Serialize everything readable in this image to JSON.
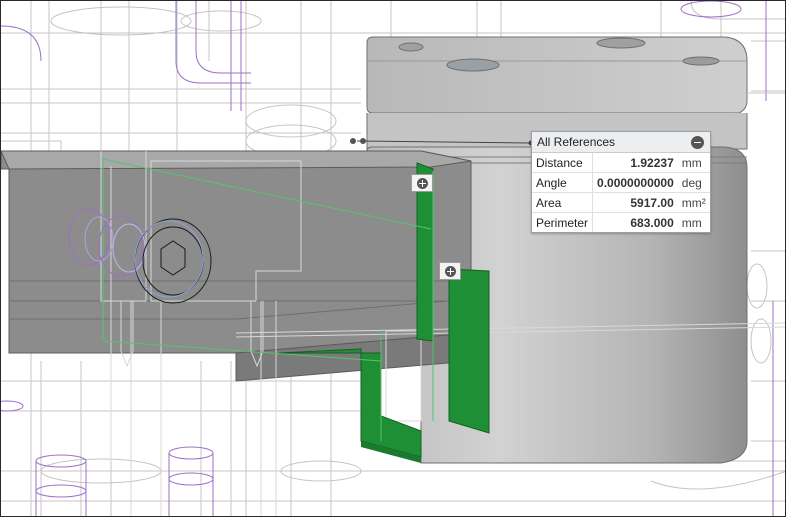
{
  "panel": {
    "title": "All References",
    "rows": [
      {
        "label": "Distance",
        "value": "1.92237",
        "unit": "mm"
      },
      {
        "label": "Angle",
        "value": "0.0000000000",
        "unit": "deg"
      },
      {
        "label": "Area",
        "value": "5917.00",
        "unit": "mm²"
      },
      {
        "label": "Perimeter",
        "value": "683.000",
        "unit": "mm"
      }
    ]
  },
  "colors": {
    "selected_face": "#1f8f36",
    "solid_gray": "#8c8c8c",
    "wireframe_purple": "#9b6fc8",
    "wireframe_gray": "#b5b5b5"
  }
}
